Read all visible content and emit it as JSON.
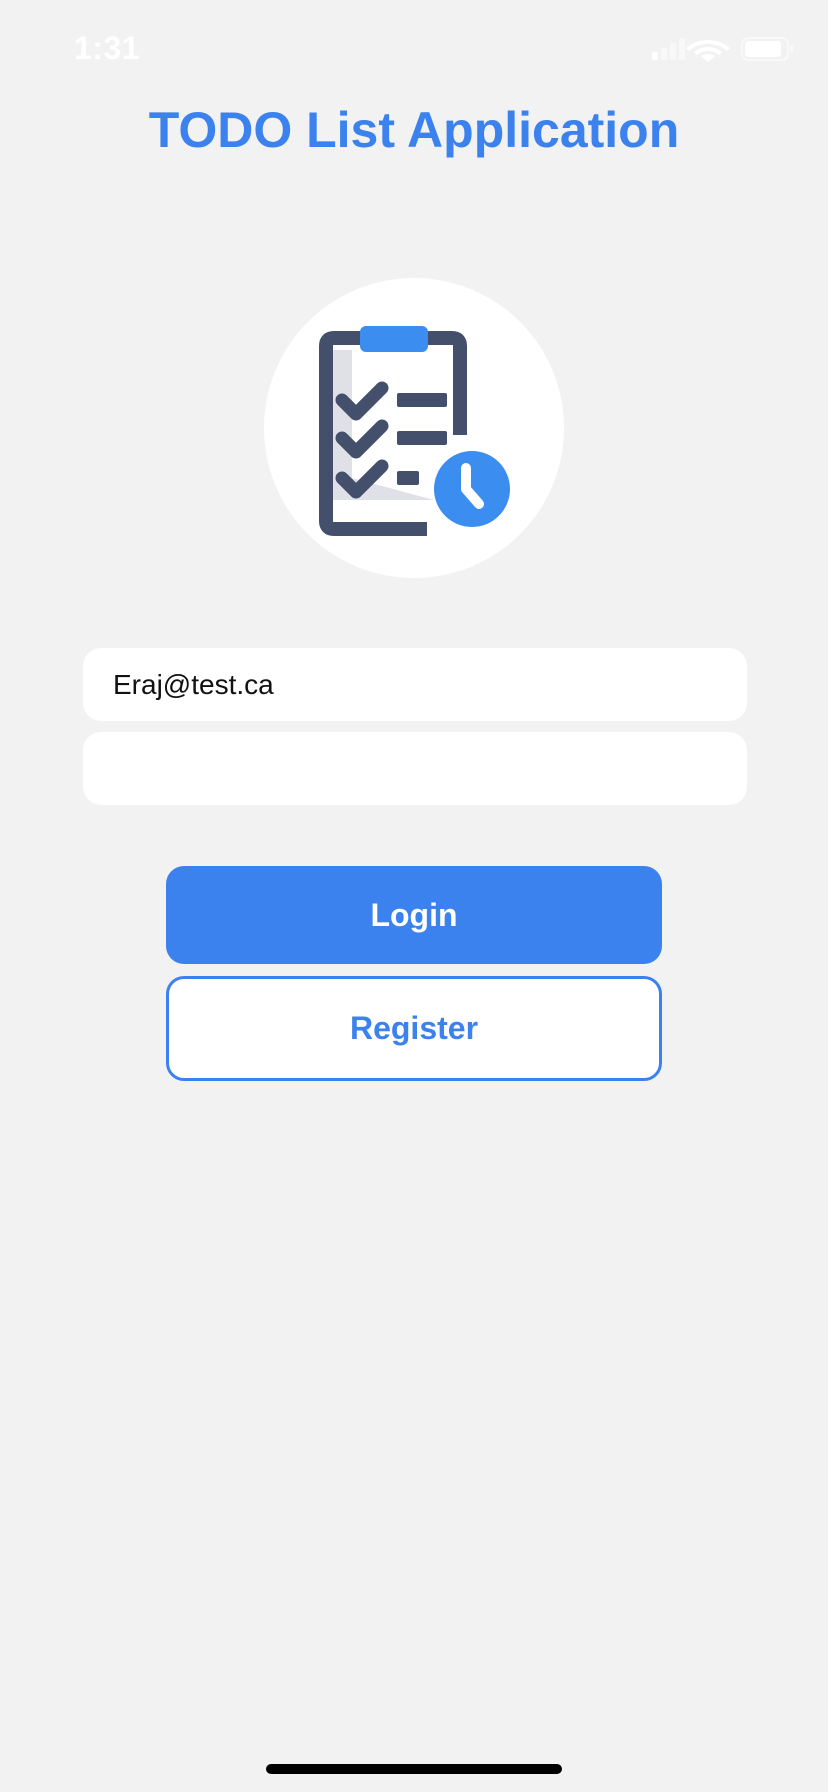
{
  "status_bar": {
    "time": "1:31"
  },
  "title": "TODO List Application",
  "logo": {
    "icon": "clipboard-checklist-clock-icon",
    "colors": {
      "dark": "#434f6b",
      "accent": "#3b8def",
      "shadow": "#dfe1e6"
    }
  },
  "form": {
    "email_value": "Eraj@test.ca",
    "password_value": ""
  },
  "buttons": {
    "login_label": "Login",
    "register_label": "Register"
  },
  "theme": {
    "accent": "#3b82ee",
    "background": "#f2f2f3"
  }
}
